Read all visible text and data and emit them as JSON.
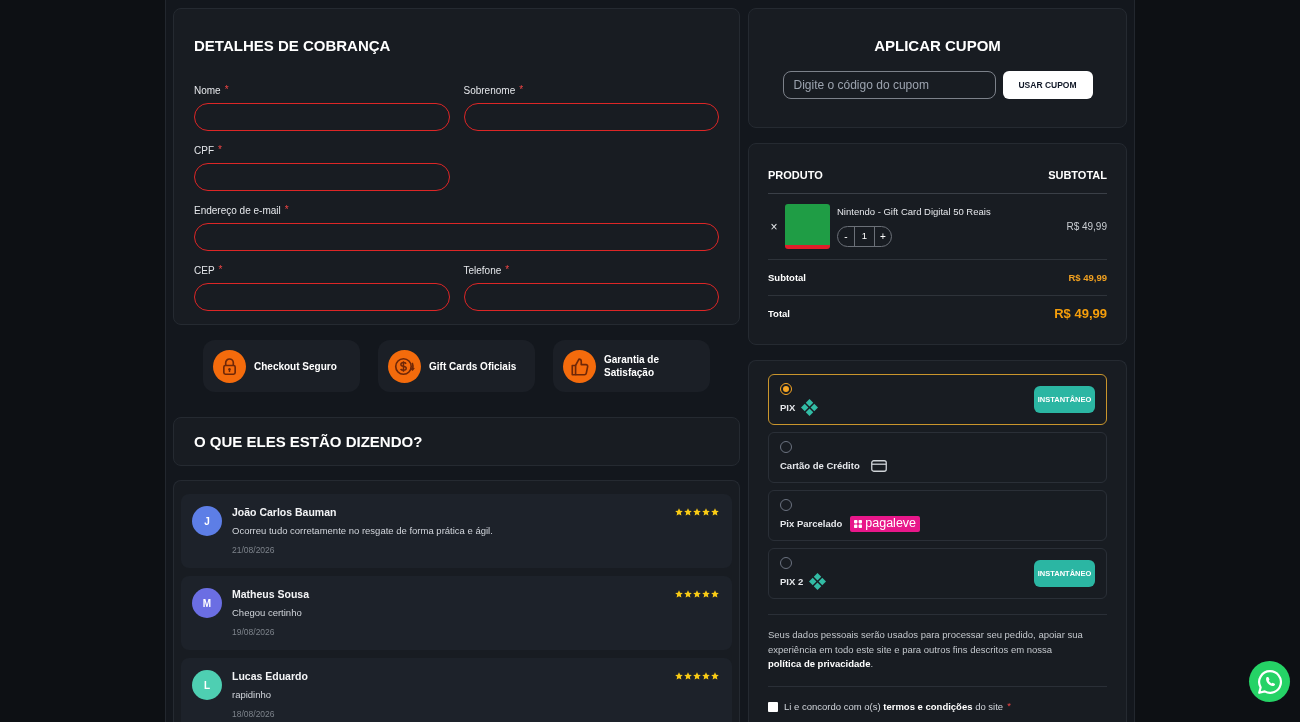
{
  "billing": {
    "title": "DETALHES DE COBRANÇA",
    "fields": [
      {
        "label": "Nome",
        "kind": "text",
        "required_mark": "*",
        "invalid": true
      },
      {
        "label": "Sobrenome",
        "kind": "text",
        "required_mark": "*",
        "invalid": true
      },
      {
        "label": "CPF",
        "kind": "text",
        "required_mark": "*",
        "invalid": true
      },
      {
        "label": "Endereço de e-mail",
        "kind": "email",
        "required_mark": "*",
        "invalid": true
      },
      {
        "label": "CEP",
        "kind": "text",
        "required_mark": "*",
        "invalid": true
      },
      {
        "label": "Telefone",
        "kind": "text",
        "required_mark": "*",
        "invalid": true
      }
    ]
  },
  "trust_badges": [
    {
      "kind": "lock",
      "text": "Checkout Seguro"
    },
    {
      "kind": "coin",
      "text": "Gift Cards Oficiais"
    },
    {
      "kind": "thumbs",
      "text": "Garantia de Satisfação"
    }
  ],
  "reviews": {
    "title": "O QUE ELES ESTÃO DIZENDO?",
    "items": [
      {
        "initial": "J",
        "color": "#5d7ee6",
        "name": "João Carlos Bauman",
        "text": "Ocorreu tudo corretamente no resgate de forma prática e ágil.",
        "date": "21/08/2026",
        "stars": 5
      },
      {
        "initial": "M",
        "color": "#6b6ee3",
        "name": "Matheus Sousa",
        "text": "Chegou certinho",
        "date": "19/08/2026",
        "stars": 5
      },
      {
        "initial": "L",
        "color": "#4ecfb2",
        "name": "Lucas Eduardo",
        "text": "rapidinho",
        "date": "18/08/2026",
        "stars": 5
      }
    ]
  },
  "coupon": {
    "title": "APLICAR CUPOM",
    "placeholder": "Digite o código do cupom",
    "button": "USAR CUPOM"
  },
  "order": {
    "columns": [
      "PRODUTO",
      "SUBTOTAL"
    ],
    "items": [
      {
        "remove": "×",
        "name": "Nintendo - Gift Card Digital 50 Reais",
        "decrement": "-",
        "quantity": "1",
        "increment": "+",
        "price": "R$ 49,99"
      }
    ],
    "subtotal": {
      "label": "Subtotal",
      "value": "R$ 49,99"
    },
    "total": {
      "label": "Total",
      "value": "R$ 49,99"
    }
  },
  "payment": {
    "methods": [
      {
        "label": "PIX",
        "kind": "pix",
        "selected": true,
        "badge": "INSTANTÂNEO"
      },
      {
        "label": "Cartão de Crédito",
        "kind": "card",
        "selected": false
      },
      {
        "label": "Pix Parcelado",
        "kind": "pagaleve",
        "selected": false,
        "logo": "pagaleve"
      },
      {
        "label": "PIX 2",
        "kind": "pix",
        "selected": false,
        "badge": "INSTANTÂNEO"
      }
    ],
    "privacy": {
      "before": "Seus dados pessoais serão usados para processar seu pedido, apoiar sua experiência em todo este site e para outros fins descritos em nossa ",
      "link": "política de privacidade",
      "after": "."
    },
    "terms": {
      "checked": false,
      "before": "Li e concordo com o(s) ",
      "link": "termos e condições",
      "after": " do site",
      "required_mark": "*"
    }
  }
}
